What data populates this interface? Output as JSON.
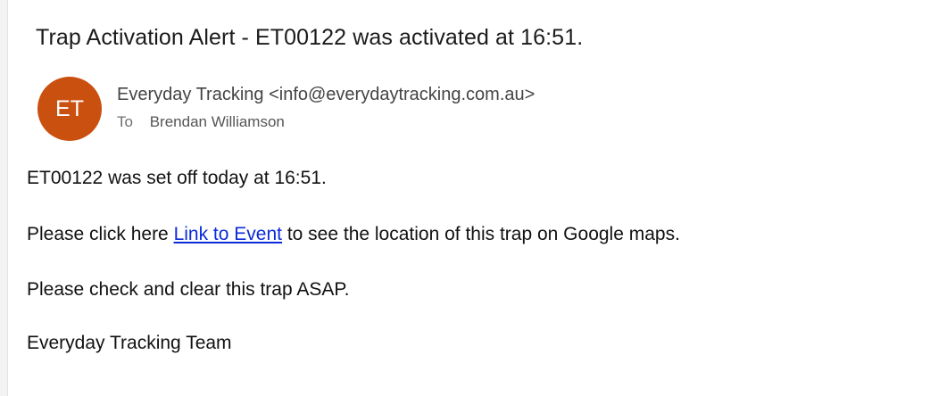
{
  "email": {
    "subject": "Trap Activation Alert - ET00122 was activated at 16:51.",
    "avatar_initials": "ET",
    "avatar_color": "#ca5010",
    "sender": "Everyday Tracking <info@everydaytracking.com.au>",
    "to_label": "To",
    "recipient": "Brendan Williamson",
    "body": {
      "line1": "ET00122 was set off today at 16:51.",
      "line2_prefix": "Please click here ",
      "link_text": "Link to Event",
      "line2_suffix": " to see the location of this trap on Google maps.",
      "line3": "Please check and clear this trap ASAP.",
      "signature": "Everyday Tracking Team"
    },
    "link_color": "#0b2bd9"
  }
}
